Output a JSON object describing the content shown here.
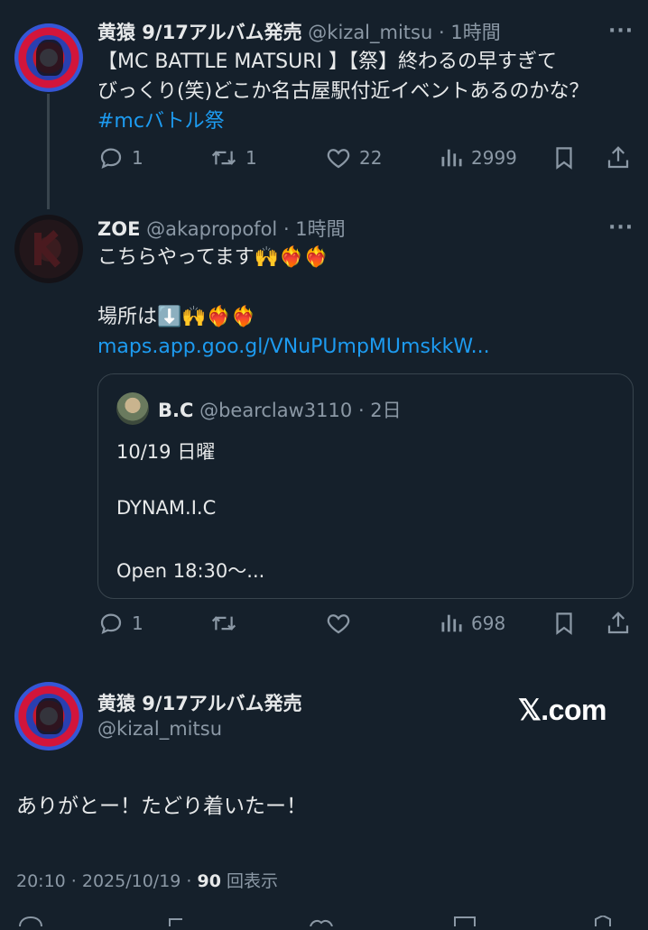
{
  "tweet1": {
    "display_name": "黄猿 9/17アルバム発売",
    "handle": "@kizal_mitsu",
    "time": "· 1時間",
    "more": "···",
    "line1": "【MC BATTLE MATSURI 】【祭】終わるの早すぎて",
    "line2": "びっくり(笑)どこか名古屋駅付近イベントあるのかな？",
    "hashtag": "#mcバトル祭",
    "replies": "1",
    "reposts": "1",
    "likes": "22",
    "views": "2999"
  },
  "tweet2": {
    "display_name": "ZOE",
    "handle": "@akapropofol",
    "time": "· 1時間",
    "more": "···",
    "line1": "こちらやってます🙌❤️‍🔥❤️‍🔥",
    "line2": "場所は⬇️🙌❤️‍🔥❤️‍🔥",
    "link": "maps.app.goo.gl/VNuPUmpMUmskkW...",
    "quote": {
      "display_name": "B.C",
      "handle": "@bearclaw3110",
      "time": "· 2日",
      "line1": "10/19 日曜",
      "line2": "DYNAM.I.C",
      "line3": "Open 18:30〜..."
    },
    "replies": "1",
    "reposts": "",
    "likes": "",
    "views": "698"
  },
  "main_tweet": {
    "display_name": "黄猿 9/17アルバム発売",
    "handle": "@kizal_mitsu",
    "brand": "𝕏.com",
    "text": "ありがとー！たどり着いたー！",
    "time": "20:10 · 2025/10/19 · ",
    "views_count": "90",
    "views_label": " 回表示"
  },
  "icons": [
    "reply-icon",
    "repost-icon",
    "like-icon",
    "views-icon",
    "bookmark-icon",
    "share-icon",
    "more-icon"
  ],
  "colors": {
    "background": "#15202b",
    "link": "#1d9bf0",
    "muted": "#8b98a5",
    "text": "#e7e9ea"
  }
}
